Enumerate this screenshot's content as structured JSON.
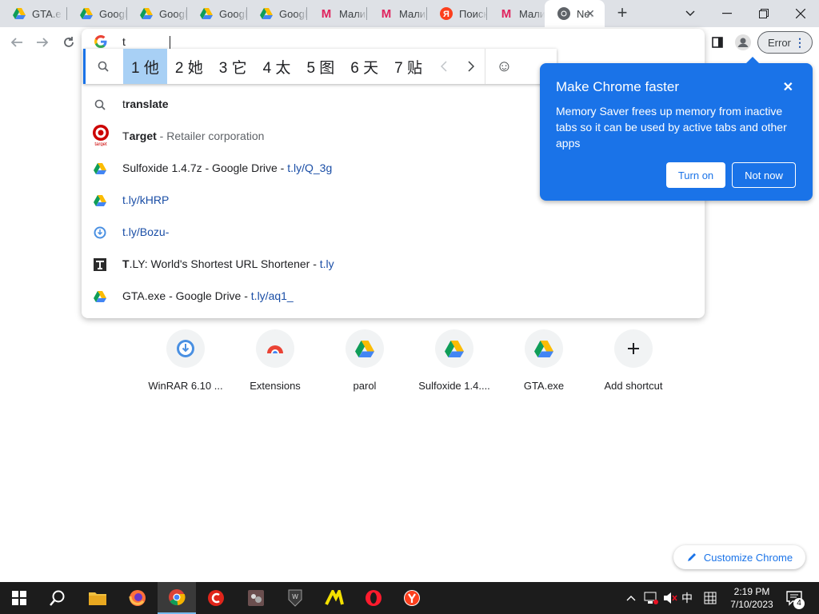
{
  "tabs": [
    {
      "title": "GTA.exe",
      "icon": "google-drive-icon"
    },
    {
      "title": "Google Drive",
      "icon": "google-drive-icon"
    },
    {
      "title": "Google Drive",
      "icon": "google-drive-icon"
    },
    {
      "title": "Google Drive",
      "icon": "google-drive-icon"
    },
    {
      "title": "Google Drive",
      "icon": "google-drive-icon"
    },
    {
      "title": "Малина",
      "icon": "yandex-market-icon"
    },
    {
      "title": "Малина",
      "icon": "yandex-market-icon"
    },
    {
      "title": "Поиск",
      "icon": "yandex-icon"
    },
    {
      "title": "Малина",
      "icon": "yandex-market-icon"
    },
    {
      "title": "New Tab",
      "icon": "chrome-icon"
    }
  ],
  "omnibox": {
    "typed": "t",
    "search_engine_icon": "google-icon"
  },
  "profile": {
    "error_label": "Error"
  },
  "ime": {
    "candidates": [
      "1 他",
      "2 她",
      "3 它",
      "4 太",
      "5 图",
      "6 天",
      "7 贴"
    ],
    "selected_index": 0,
    "emoji": "☺"
  },
  "suggestions": [
    {
      "icon": "search-icon",
      "bold": "t",
      "rest": "ranslate",
      "desc": "",
      "url": ""
    },
    {
      "icon": "target-icon",
      "bold": "T",
      "rest": "arget",
      "desc": " - Retailer corporation",
      "url": ""
    },
    {
      "icon": "google-drive-icon",
      "bold": "",
      "rest": "Sulfoxide 1.4.7z - Google Drive - ",
      "desc": "",
      "url": "t.ly/Q_3g"
    },
    {
      "icon": "google-drive-icon",
      "bold": "",
      "rest": "",
      "desc": "",
      "url": "t.ly/kHRP"
    },
    {
      "icon": "download-icon",
      "bold": "",
      "rest": "",
      "desc": "",
      "url": "t.ly/Bozu-"
    },
    {
      "icon": "tly-icon",
      "bold": "T",
      "rest": ".LY: World's Shortest URL Shortener - ",
      "desc": "",
      "url": "t.ly"
    },
    {
      "icon": "google-drive-icon",
      "bold": "",
      "rest": "GTA.exe - Google Drive - ",
      "desc": "",
      "url": "t.ly/aq1_"
    }
  ],
  "bubble": {
    "title": "Make Chrome faster",
    "body": "Memory Saver frees up memory from inactive tabs so it can be used by active tabs and other apps",
    "turn_on": "Turn on",
    "not_now": "Not now"
  },
  "shortcuts": [
    {
      "label": "WinRAR 6.10 ...",
      "icon": "download-icon"
    },
    {
      "label": "Extensions",
      "icon": "chrome-icon"
    },
    {
      "label": "parol",
      "icon": "google-drive-icon"
    },
    {
      "label": "Sulfoxide 1.4....",
      "icon": "google-drive-icon"
    },
    {
      "label": "GTA.exe",
      "icon": "google-drive-icon"
    },
    {
      "label": "Add shortcut",
      "icon": "plus-icon"
    }
  ],
  "customize": {
    "label": "Customize Chrome"
  },
  "taskbar": {
    "apps": [
      "windows-start-icon",
      "search-icon",
      "file-explorer-icon",
      "firefox-icon",
      "chrome-icon",
      "ccleaner-icon",
      "game-icon",
      "world-of-tanks-icon",
      "app-icon",
      "opera-icon",
      "yandex-browser-icon"
    ],
    "ime_indicator": "中",
    "clock_time": "2:19 PM",
    "clock_date": "7/10/2023",
    "notifications": "4"
  },
  "colors": {
    "accent": "#1a73e8",
    "tabstrip": "#dee1e6",
    "taskbar": "#1c1c1c"
  }
}
